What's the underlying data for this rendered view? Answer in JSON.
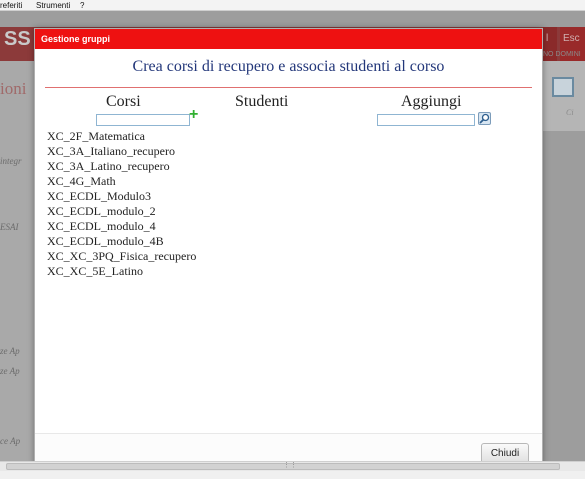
{
  "menubar": {
    "item_favorites": "referiti",
    "item_tools": "Strumenti",
    "item_help": "?"
  },
  "background": {
    "logo_text": "SS",
    "big_left_text": "ioni",
    "left_labels": [
      "integr",
      "ESAI",
      "ze Ap",
      "ze Ap",
      "ce Ap"
    ],
    "right_button_1": "l",
    "right_button_2": "Esc",
    "right_label": "NO DOMINI",
    "right_small": "Ci"
  },
  "dialog": {
    "title": "Gestione gruppi",
    "heading": "Crea corsi di recupero e associa studenti al corso",
    "columns": {
      "courses": "Corsi",
      "students": "Studenti",
      "add": "Aggiungi"
    },
    "courses_input": {
      "value": "",
      "placeholder": ""
    },
    "add_input": {
      "value": "",
      "placeholder": ""
    },
    "add_course_icon": "plus-icon",
    "search_icon": "magnifier-icon",
    "courses": [
      "XC_2F_Matematica",
      "XC_3A_Italiano_recupero",
      "XC_3A_Latino_recupero",
      "XC_4G_Math",
      "XC_ECDL_Modulo3",
      "XC_ECDL_modulo_2",
      "XC_ECDL_modulo_4",
      "XC_ECDL_modulo_4B",
      "XC_XC_3PQ_Fisica_recupero",
      "XC_XC_5E_Latino"
    ],
    "close_label": "Chiudi"
  },
  "colors": {
    "title_bar": "#ee1111",
    "heading": "#23377a",
    "plus": "#30b030"
  }
}
